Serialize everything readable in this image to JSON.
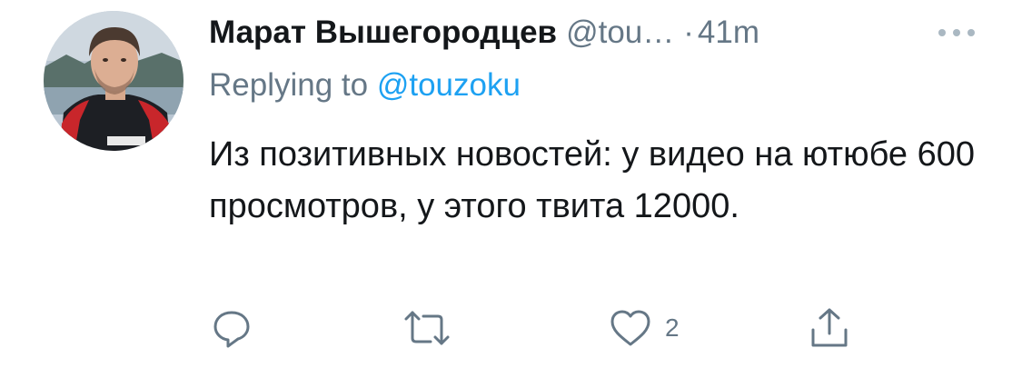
{
  "tweet": {
    "author_name": "Марат Вышегородцев",
    "author_handle": "@tou…",
    "separator": "·",
    "time": "41m",
    "replying_prefix": "Replying to ",
    "replying_handle": "@touzoku",
    "text": "Из позитивных новостей: у видео на ютюбе 600 просмотров, у этого твита 12000.",
    "actions": {
      "reply_icon": "reply-icon",
      "retweet_icon": "retweet-icon",
      "like_icon": "like-icon",
      "like_count": "2",
      "share_icon": "share-icon"
    },
    "more_icon": "more-icon"
  },
  "colors": {
    "text": "#14171a",
    "muted": "#657786",
    "link": "#1da1f2"
  }
}
